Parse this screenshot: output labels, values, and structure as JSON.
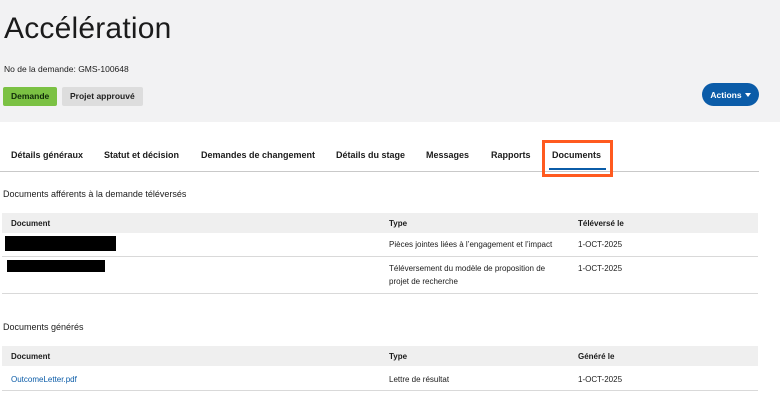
{
  "header": {
    "title": "Accélération",
    "request_number": "No de la demande: GMS-100648",
    "badges": [
      "Demande",
      "Projet approuvé"
    ],
    "actions_label": "Actions"
  },
  "tabs": [
    {
      "label": "Détails généraux"
    },
    {
      "label": "Statut et décision"
    },
    {
      "label": "Demandes de changement"
    },
    {
      "label": "Détails du stage"
    },
    {
      "label": "Messages"
    },
    {
      "label": "Rapports"
    },
    {
      "label": "Documents",
      "active": true
    }
  ],
  "uploaded": {
    "title": "Documents afférents à la demande téléversés",
    "columns": [
      "Document",
      "Type",
      "Téléversé le"
    ],
    "rows": [
      {
        "document": "",
        "redacted": true,
        "type": "Pièces jointes liées à l’engagement et l’impact",
        "date": "1-OCT-2025"
      },
      {
        "document": "",
        "redacted": true,
        "type_line1": "Téléversement du modèle de proposition de",
        "type_line2": "projet de recherche",
        "date": "1-OCT-2025"
      }
    ]
  },
  "generated": {
    "title": "Documents générés",
    "columns": [
      "Document",
      "Type",
      "Généré le"
    ],
    "rows": [
      {
        "document": "OutcomeLetter.pdf",
        "type": "Lettre de résultat",
        "date": "1-OCT-2025"
      }
    ]
  },
  "colors": {
    "accent": "#0b5ca8",
    "badge_green": "#7bc143",
    "highlight": "#ff5a1f"
  }
}
